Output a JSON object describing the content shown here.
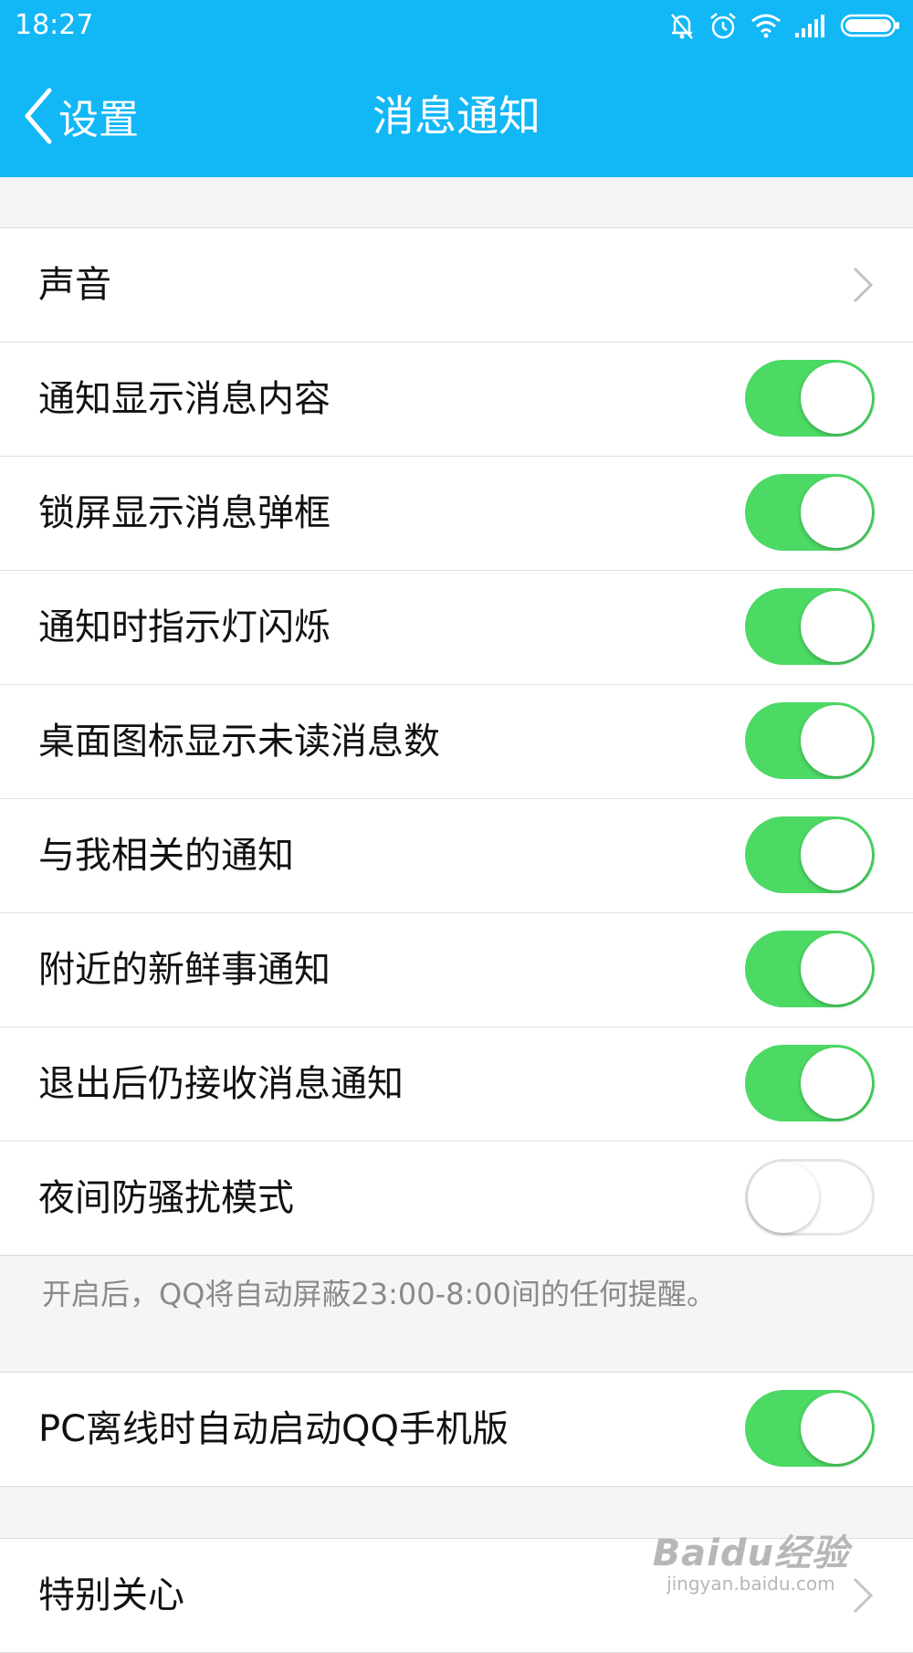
{
  "status_bar": {
    "time": "18:27",
    "icons": [
      "bell-muted-icon",
      "alarm-icon",
      "wifi-icon",
      "signal-icon",
      "battery-icon"
    ]
  },
  "nav": {
    "back_label": "设置",
    "title": "消息通知"
  },
  "settings": [
    {
      "label": "声音",
      "type": "link"
    },
    {
      "label": "通知显示消息内容",
      "type": "toggle",
      "on": true
    },
    {
      "label": "锁屏显示消息弹框",
      "type": "toggle",
      "on": true
    },
    {
      "label": "通知时指示灯闪烁",
      "type": "toggle",
      "on": true
    },
    {
      "label": "桌面图标显示未读消息数",
      "type": "toggle",
      "on": true
    },
    {
      "label": "与我相关的通知",
      "type": "toggle",
      "on": true
    },
    {
      "label": "附近的新鲜事通知",
      "type": "toggle",
      "on": true
    },
    {
      "label": "退出后仍接收消息通知",
      "type": "toggle",
      "on": true
    },
    {
      "label": "夜间防骚扰模式",
      "type": "toggle",
      "on": false
    }
  ],
  "night_mode_note": "开启后，QQ将自动屏蔽23:00-8:00间的任何提醒。",
  "pc_offline": {
    "label": "PC离线时自动启动QQ手机版",
    "type": "toggle",
    "on": true
  },
  "special_care": {
    "label": "特别关心",
    "type": "link"
  },
  "watermark": {
    "main": "Baidu经验",
    "sub": "jingyan.baidu.com"
  },
  "colors": {
    "header": "#12b7f5",
    "toggle_on": "#4cd964",
    "background": "#f5f5f7"
  }
}
